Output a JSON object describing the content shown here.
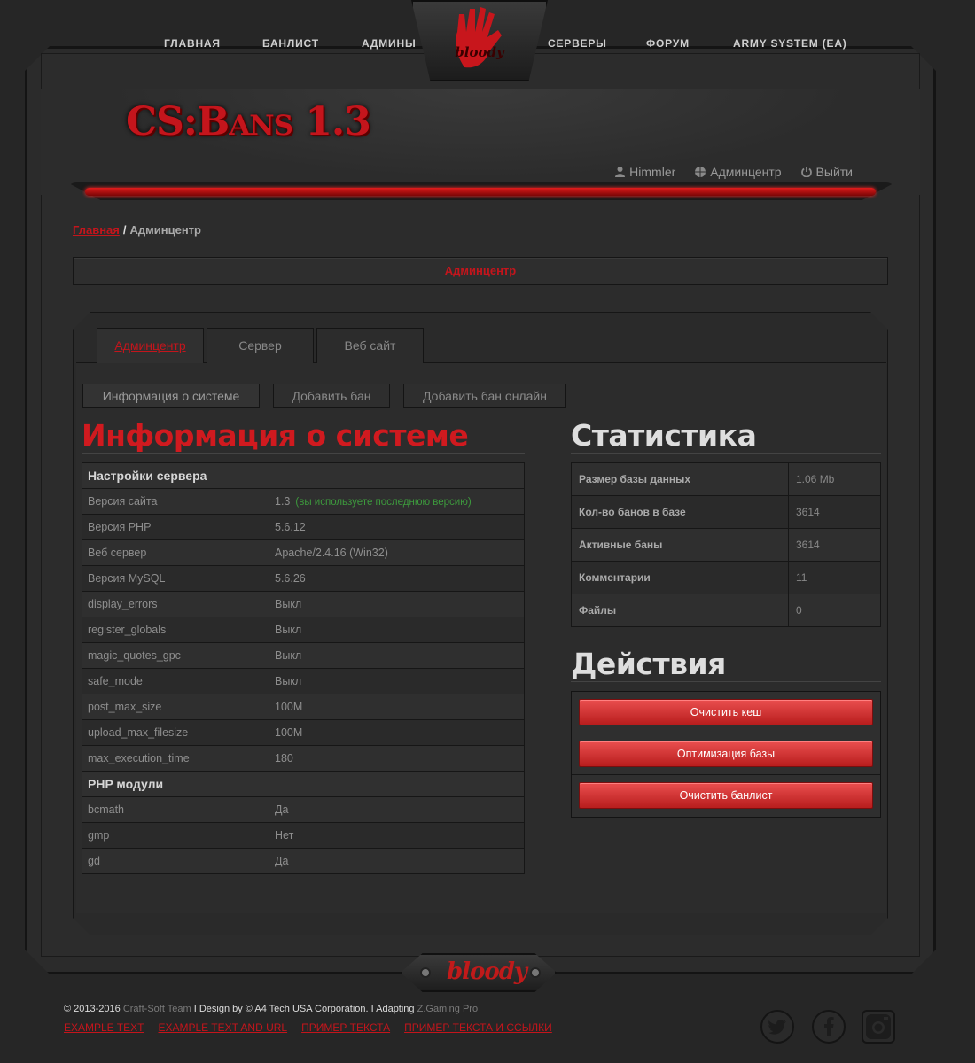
{
  "nav": {
    "items": [
      "ГЛАВНАЯ",
      "БАНЛИСТ",
      "АДМИНЫ",
      "СЕРВЕРЫ",
      "ФОРУМ",
      "ARMY SYSTEM (EA)"
    ],
    "logo_text": "bloody"
  },
  "header": {
    "site_title": "CS:Bans 1.3",
    "user": "Himmler",
    "admin_link": "Админцентр",
    "logout": "Выйти"
  },
  "breadcrumb": {
    "home": "Главная",
    "separator": "/",
    "current": "Админцентр"
  },
  "page_title": "Админцентр",
  "tabs": [
    {
      "label": "Админцентр",
      "active": true
    },
    {
      "label": "Сервер",
      "active": false
    },
    {
      "label": "Веб сайт",
      "active": false
    }
  ],
  "subtabs": [
    {
      "label": "Информация о системе",
      "active": true
    },
    {
      "label": "Добавить бан",
      "active": false
    },
    {
      "label": "Добавить бан онлайн",
      "active": false
    }
  ],
  "sysinfo": {
    "heading": "Информация о системе",
    "server_section": "Настройки сервера",
    "rows": [
      {
        "k": "Версия сайта",
        "v": "1.3",
        "note": "(вы используете последнюю версию)"
      },
      {
        "k": "Версия PHP",
        "v": "5.6.12"
      },
      {
        "k": "Веб сервер",
        "v": "Apache/2.4.16 (Win32)"
      },
      {
        "k": "Версия MySQL",
        "v": "5.6.26"
      },
      {
        "k": "display_errors",
        "v": "Выкл"
      },
      {
        "k": "register_globals",
        "v": "Выкл"
      },
      {
        "k": "magic_quotes_gpc",
        "v": "Выкл"
      },
      {
        "k": "safe_mode",
        "v": "Выкл"
      },
      {
        "k": "post_max_size",
        "v": "100M"
      },
      {
        "k": "upload_max_filesize",
        "v": "100M"
      },
      {
        "k": "max_execution_time",
        "v": "180"
      }
    ],
    "modules_section": "PHP модули",
    "modules": [
      {
        "k": "bcmath",
        "v": "Да"
      },
      {
        "k": "gmp",
        "v": "Нет"
      },
      {
        "k": "gd",
        "v": "Да"
      }
    ]
  },
  "stats": {
    "heading": "Статистика",
    "rows": [
      {
        "k": "Размер базы данных",
        "v": "1.06 Mb"
      },
      {
        "k": "Кол-во банов в базе",
        "v": "3614"
      },
      {
        "k": "Активные баны",
        "v": "3614"
      },
      {
        "k": "Комментарии",
        "v": "11"
      },
      {
        "k": "Файлы",
        "v": "0"
      }
    ]
  },
  "actions": {
    "heading": "Действия",
    "buttons": [
      "Очистить кеш",
      "Оптимизация базы",
      "Очистить банлист"
    ]
  },
  "footer": {
    "logo_text": "bloody",
    "copyright_prefix": "© 2013-2016",
    "team": "Craft-Soft Team",
    "design": "I Design by © A4 Tech USA Corporation. I Adapting",
    "adapter": "Z.Gaming Pro",
    "links": [
      "EXAMPLE TEXT",
      "EXAMPLE TEXT AND URL",
      "ПРИМЕР ТЕКСТА",
      "ПРИМЕР ТЕКСТА И ССЫЛКИ"
    ],
    "social": [
      "twitter-icon",
      "facebook-icon",
      "instagram-icon"
    ]
  },
  "colors": {
    "accent_red": "#c4151c",
    "button_red": "#d63a3a",
    "background": "#262626",
    "note_green": "#3d9a3d"
  }
}
